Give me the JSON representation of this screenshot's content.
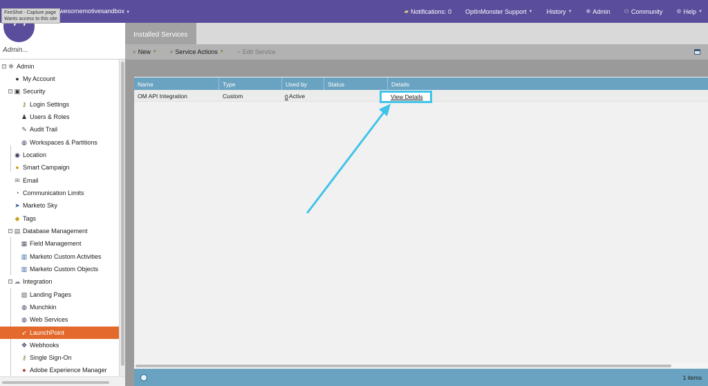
{
  "topbar": {
    "tooltip_line1": "FireShot - Capture page",
    "tooltip_line2": "Wants access to this site",
    "workspace": "wesomemotivesandbox",
    "nav": [
      {
        "label": "Notifications: 0",
        "icon": "notifications-icon"
      },
      {
        "label": "OptInMonster Support",
        "icon": ""
      },
      {
        "label": "History",
        "icon": ""
      },
      {
        "label": "Admin",
        "icon": "gear-icon"
      },
      {
        "label": "Community",
        "icon": "community-icon"
      },
      {
        "label": "Help",
        "icon": "help-icon"
      }
    ]
  },
  "left_panel": {
    "title": "Admin...",
    "tree": [
      {
        "label": "Admin",
        "icon": "gear-icon"
      },
      {
        "label": "My Account",
        "icon": "user-icon"
      },
      {
        "label": "Security",
        "icon": "lock-icon"
      },
      {
        "label": "Login Settings",
        "icon": "key-icon"
      },
      {
        "label": "Users & Roles",
        "icon": "users-icon"
      },
      {
        "label": "Audit Trail",
        "icon": "audit-icon"
      },
      {
        "label": "Workspaces & Partitions",
        "icon": "globe-icon"
      },
      {
        "label": "Location",
        "icon": "location-icon"
      },
      {
        "label": "Smart Campaign",
        "icon": "bulb-icon"
      },
      {
        "label": "Email",
        "icon": "email-icon"
      },
      {
        "label": "Communication Limits",
        "icon": "limit-icon"
      },
      {
        "label": "Marketo Sky",
        "icon": "sky-icon"
      },
      {
        "label": "Tags",
        "icon": "tag-icon"
      },
      {
        "label": "Database Management",
        "icon": "database-icon"
      },
      {
        "label": "Field Management",
        "icon": "field-icon"
      },
      {
        "label": "Marketo Custom Activities",
        "icon": "custom-activities-icon"
      },
      {
        "label": "Marketo Custom Objects",
        "icon": "custom-objects-icon"
      },
      {
        "label": "Integration",
        "icon": "cloud-icon"
      },
      {
        "label": "Landing Pages",
        "icon": "landing-pages-icon"
      },
      {
        "label": "Munchkin",
        "icon": "munchkin-icon"
      },
      {
        "label": "Web Services",
        "icon": "web-services-icon"
      },
      {
        "label": "LaunchPoint",
        "icon": "launchpoint-icon"
      },
      {
        "label": "Webhooks",
        "icon": "webhooks-icon"
      },
      {
        "label": "Single Sign-On",
        "icon": "sso-icon"
      },
      {
        "label": "Adobe Experience Manager",
        "icon": "adobe-icon"
      }
    ],
    "selected": "LaunchPoint"
  },
  "main": {
    "tab": "Installed Services",
    "toolbar": {
      "new": "New",
      "service_actions": "Service Actions",
      "edit_service": "Edit Service"
    },
    "columns": [
      "Name",
      "Type",
      "Used by",
      "Status",
      "Details"
    ],
    "rows": [
      {
        "name": "OM API Integration",
        "type": "Custom",
        "used_by": "0",
        "status": "Active",
        "details": "View Details"
      }
    ],
    "count": "1 items"
  },
  "colors": {
    "topbar": "#5a4d9c",
    "selected": "#e36a2c",
    "grid_header": "#6aa3c1",
    "highlight": "#3fc3ea"
  }
}
